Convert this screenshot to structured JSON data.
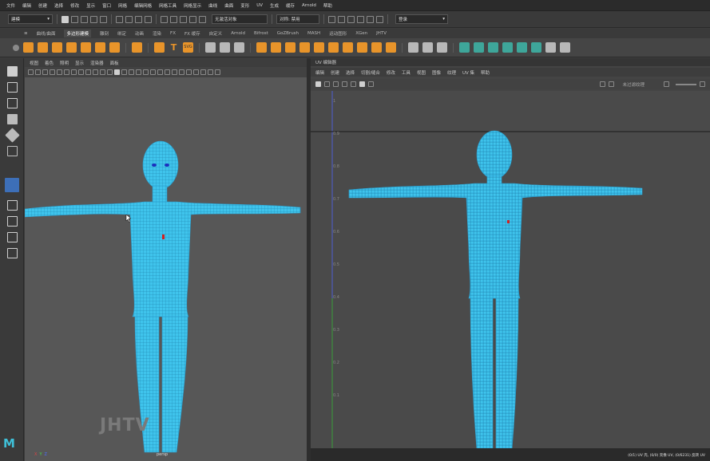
{
  "menu": [
    "文件",
    "编辑",
    "创建",
    "选择",
    "修改",
    "显示",
    "窗口",
    "网格",
    "编辑网格",
    "网格工具",
    "网格显示",
    "曲线",
    "曲面",
    "变形",
    "UV",
    "生成",
    "缓存",
    "Arnold",
    "帮助"
  ],
  "status": {
    "mode": "建模",
    "object_field": "无激活对象",
    "symmetry": "对称: 禁用",
    "login": "登录"
  },
  "shelf_tabs": [
    "曲线/曲面",
    "多边形建模",
    "雕刻",
    "绑定",
    "动画",
    "渲染",
    "FX",
    "FX 缓存",
    "自定义",
    "Arnold",
    "Bifrost",
    "GoZBrush",
    "MASH",
    "运动图形",
    "XGen",
    "JHTV"
  ],
  "active_shelf_tab": 1,
  "shelf_text_icons": {
    "t": "T",
    "svg": "SVG"
  },
  "left_viewport": {
    "menu": [
      "视图",
      "着色",
      "照明",
      "显示",
      "渲染器",
      "面板"
    ],
    "camera_label": "persp",
    "gizmo": {
      "x": "X",
      "y": "Y",
      "z": "Z"
    }
  },
  "uv_editor": {
    "title": "UV 编辑器",
    "menu": [
      "编辑",
      "创建",
      "选择",
      "切割/缝合",
      "修改",
      "工具",
      "视图",
      "图像",
      "纹理",
      "UV 集",
      "帮助"
    ],
    "texture_label": "未过滤纹理",
    "status_text": "(0/1) UV 壳, (0/0) 壳像 UV, (0/6231) 反转 UV",
    "ruler": [
      "1",
      "0.9",
      "0.8",
      "0.7",
      "0.6",
      "0.5",
      "0.4",
      "0.3",
      "0.2",
      "0.1"
    ]
  },
  "watermark": "JHTV",
  "logo": "M",
  "colors": {
    "mesh": "#3fc4ec",
    "accent": "#e8942a",
    "axis_v": "#4d5fd1",
    "axis_g": "#3b9e3b"
  }
}
